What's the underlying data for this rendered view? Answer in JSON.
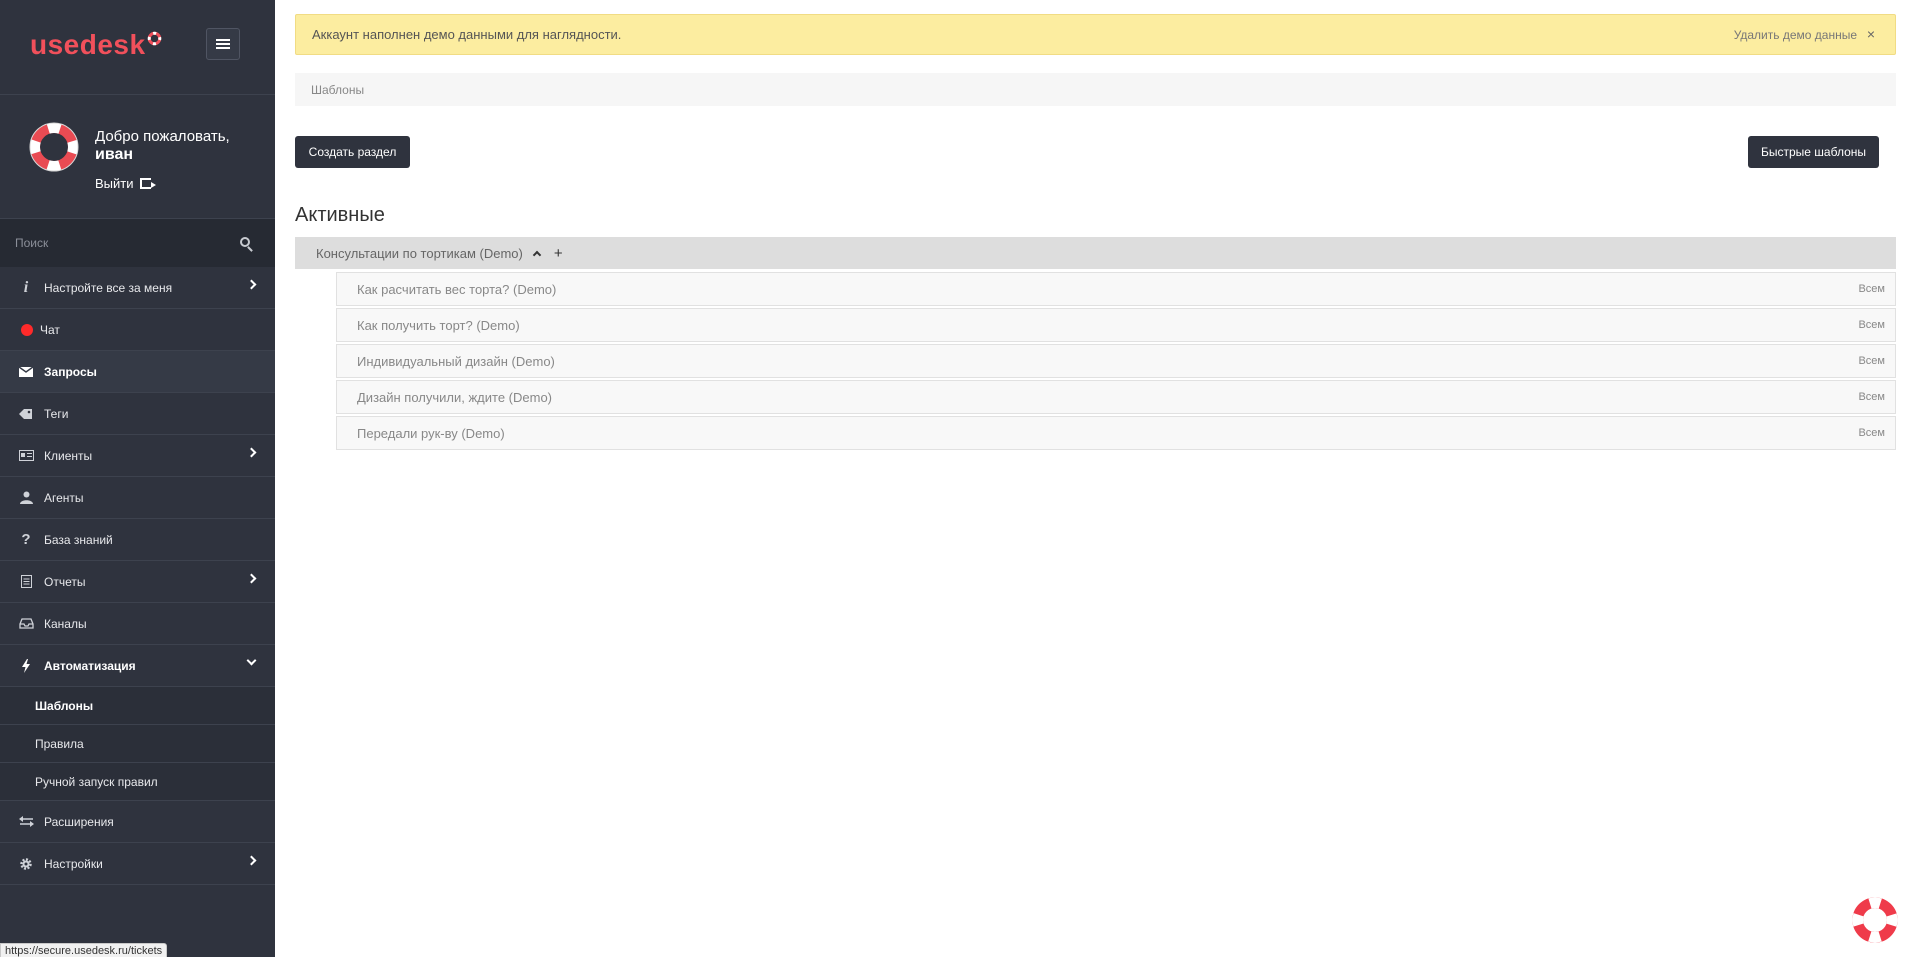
{
  "sidebar": {
    "logo": "usedesk",
    "user": {
      "welcome": "Добро пожаловать,",
      "name": "иван",
      "logout": "Выйти"
    },
    "search_placeholder": "Поиск",
    "items": [
      {
        "label": "Настройте все за меня",
        "icon": "i"
      },
      {
        "label": "Чат"
      },
      {
        "label": "Запросы"
      },
      {
        "label": "Теги"
      },
      {
        "label": "Клиенты"
      },
      {
        "label": "Агенты"
      },
      {
        "label": "База знаний",
        "icon": "?"
      },
      {
        "label": "Отчеты"
      },
      {
        "label": "Каналы"
      },
      {
        "label": "Автоматизация"
      },
      {
        "label": "Расширения"
      },
      {
        "label": "Настройки"
      }
    ],
    "subitems": [
      {
        "label": "Шаблоны"
      },
      {
        "label": "Правила"
      },
      {
        "label": "Ручной запуск правил"
      }
    ]
  },
  "status_url": "https://secure.usedesk.ru/tickets",
  "alert": {
    "text": "Аккаунт наполнен демо данными для наглядности.",
    "action": "Удалить демо данные",
    "close": "×"
  },
  "breadcrumb": "Шаблоны",
  "buttons": {
    "create_section": "Создать раздел",
    "quick_templates": "Быстрые шаблоны"
  },
  "section_title": "Активные",
  "group": {
    "title": "Консультации по тортикам (Demo)",
    "plus": "+",
    "templates": [
      {
        "title": "Как расчитать вес торта? (Demo)",
        "scope": "Всем"
      },
      {
        "title": "Как получить торт? (Demo)",
        "scope": "Всем"
      },
      {
        "title": "Индивидуальный дизайн (Demo)",
        "scope": "Всем"
      },
      {
        "title": "Дизайн получили, ждите (Demo)",
        "scope": "Всем"
      },
      {
        "title": "Передали рук-ву (Demo)",
        "scope": "Всем"
      }
    ]
  },
  "colors": {
    "sidebar_bg": "#2f333e",
    "brand": "#f1505b",
    "alert_bg": "#fceda0",
    "chat_status": "#ff2a2a"
  }
}
